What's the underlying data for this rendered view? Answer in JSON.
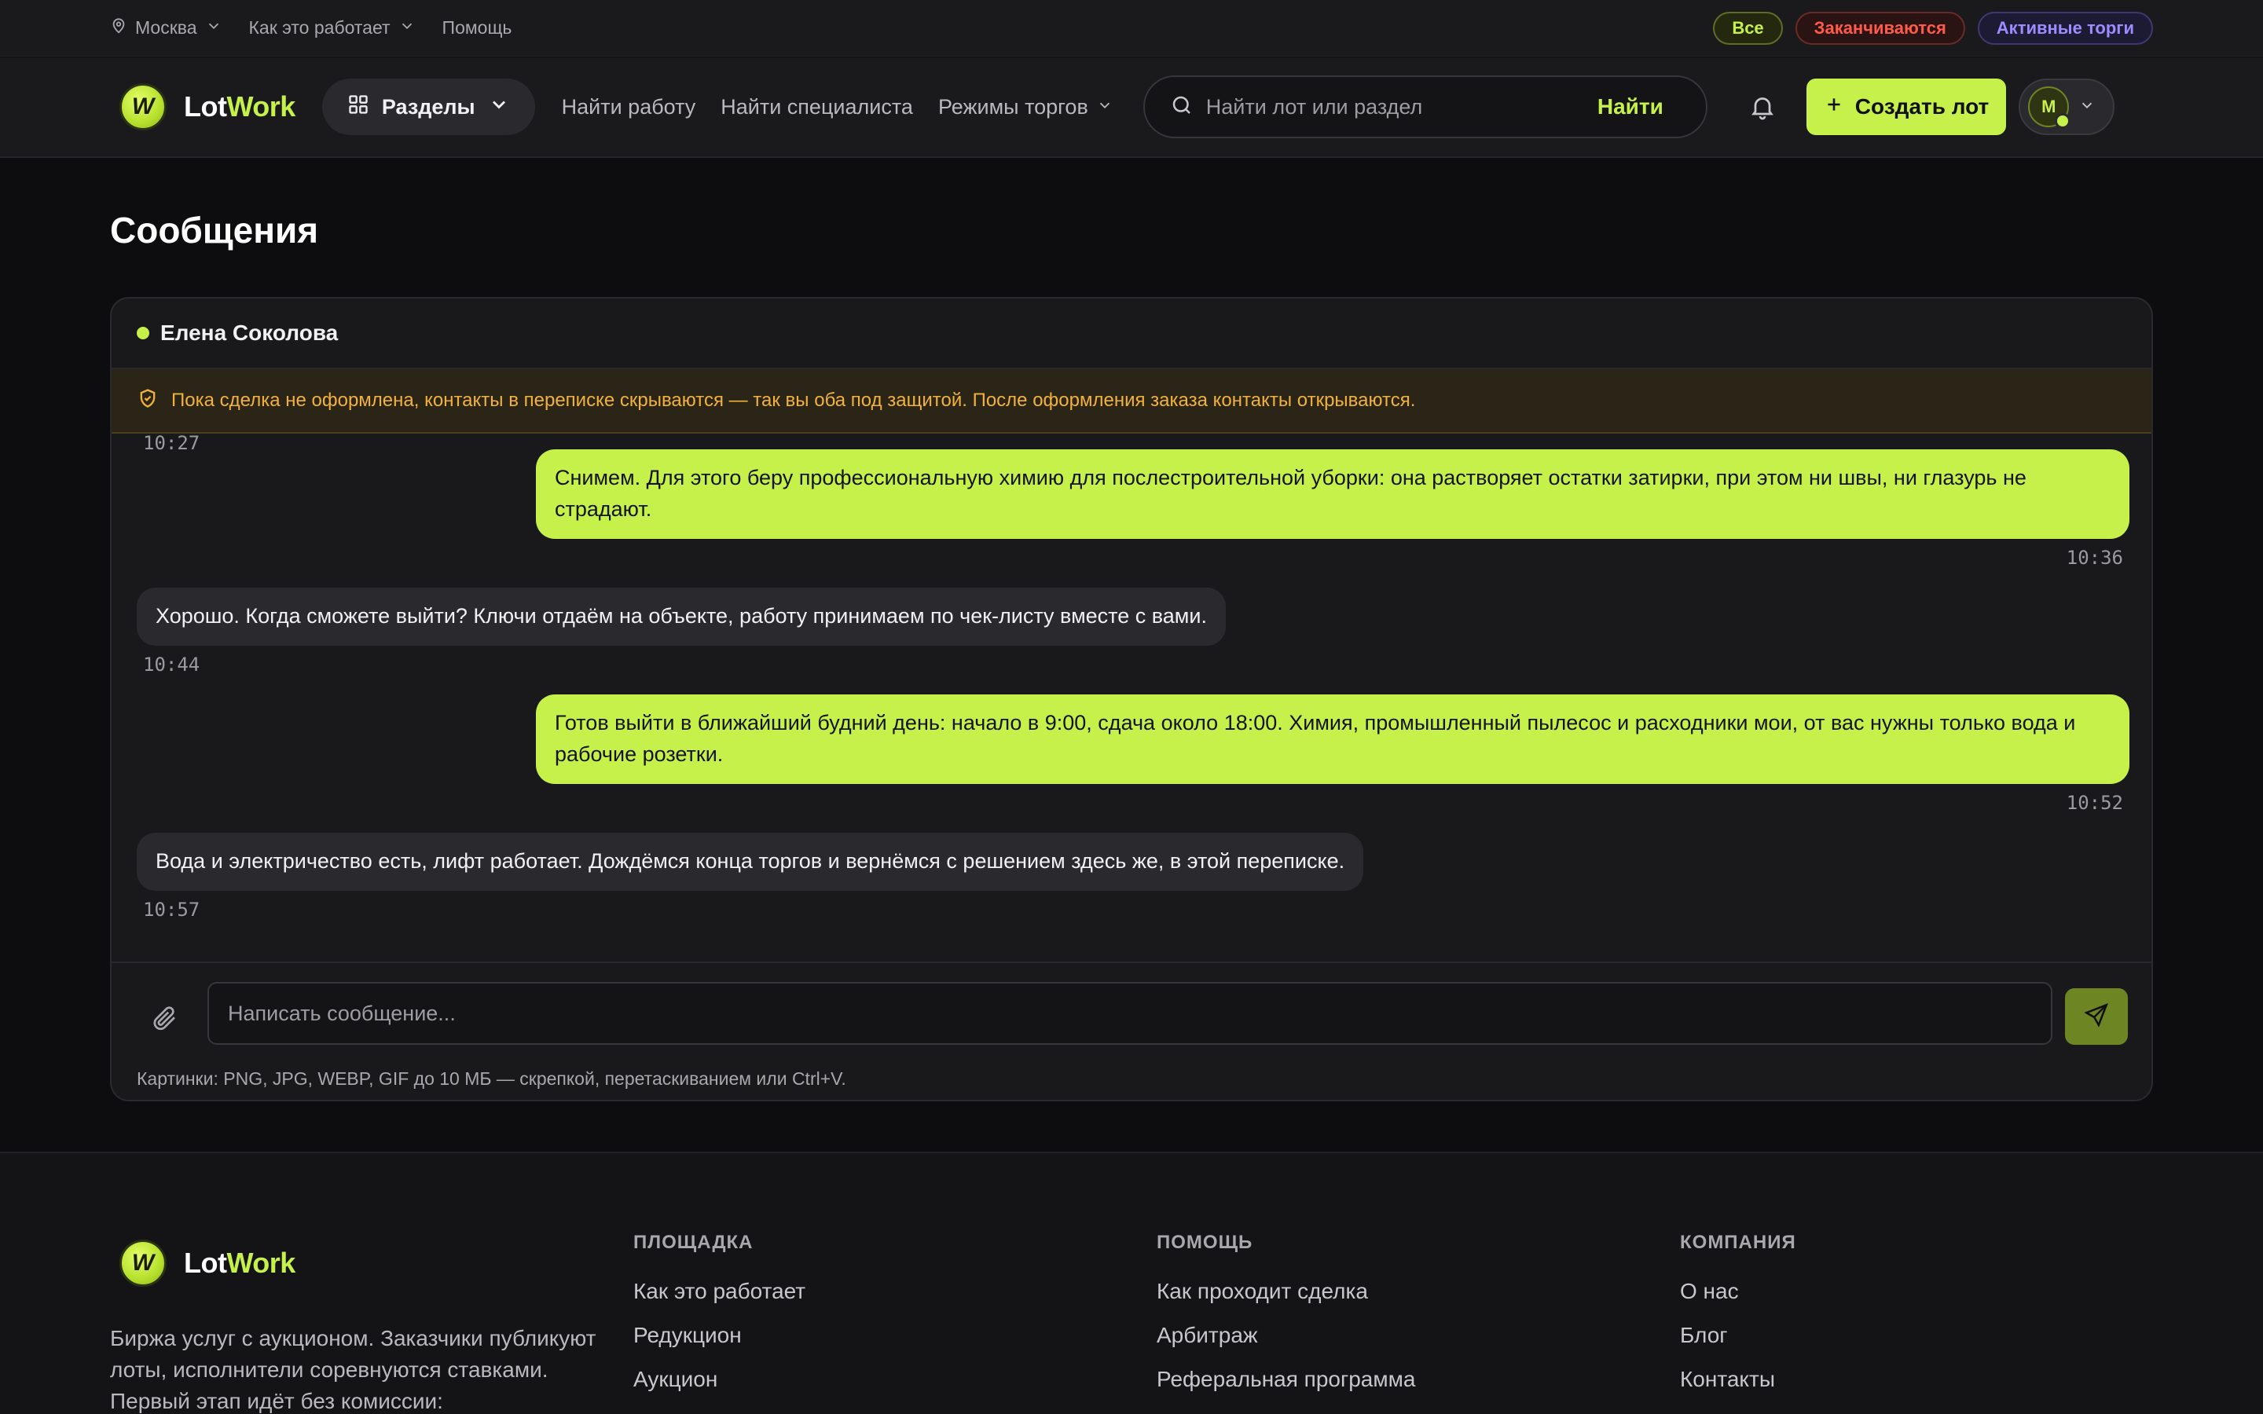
{
  "topbar": {
    "city": "Москва",
    "how_it_works": "Как это работает",
    "help": "Помощь",
    "filters": {
      "all": "Все",
      "ending": "Заканчиваются",
      "active": "Активные торги"
    }
  },
  "header": {
    "logo_lot": "Lot",
    "logo_work": "Work",
    "logo_mark": "W",
    "sections": "Разделы",
    "nav": {
      "find_job": "Найти работу",
      "find_specialist": "Найти специалиста",
      "trade_modes": "Режимы торгов"
    },
    "search_placeholder": "Найти лот или раздел",
    "search_button": "Найти",
    "create_lot": "Создать лот",
    "avatar_initial": "М"
  },
  "page": {
    "title": "Сообщения"
  },
  "chat": {
    "contact_name": "Елена Соколова",
    "notice": "Пока сделка не оформлена, контакты в переписке скрываются — так вы оба под защитой. После оформления заказа контакты открываются.",
    "cut_time": "10:27",
    "messages": [
      {
        "direction": "out",
        "text": "Снимем. Для этого беру профессиональную химию для послестроительной уборки: она растворяет остатки затирки, при этом ни швы, ни глазурь не страдают.",
        "time": "10:36"
      },
      {
        "direction": "in",
        "text": "Хорошо. Когда сможете выйти? Ключи отдаём на объекте, работу принимаем по чек-листу вместе с вами.",
        "time": "10:44"
      },
      {
        "direction": "out",
        "text": "Готов выйти в ближайший будний день: начало в 9:00, сдача около 18:00. Химия, промышленный пылесос и расходники мои, от вас нужны только вода и рабочие розетки.",
        "time": "10:52"
      },
      {
        "direction": "in",
        "text": "Вода и электричество есть, лифт работает. Дождёмся конца торгов и вернёмся с решением здесь же, в этой переписке.",
        "time": "10:57"
      }
    ],
    "input_placeholder": "Написать сообщение...",
    "hint": "Картинки: PNG, JPG, WEBP, GIF до 10 МБ — скрепкой, перетаскиванием или Ctrl+V."
  },
  "footer": {
    "about": "Биржа услуг с аукционом. Заказчики публикуют лоты, исполнители соревнуются ставками. Первый этап идёт без комиссии:",
    "columns": [
      {
        "title": "ПЛОЩАДКА",
        "links": [
          "Как это работает",
          "Редукцион",
          "Аукцион"
        ]
      },
      {
        "title": "ПОМОЩЬ",
        "links": [
          "Как проходит сделка",
          "Арбитраж",
          "Реферальная программа"
        ]
      },
      {
        "title": "КОМПАНИЯ",
        "links": [
          "О нас",
          "Блог",
          "Контакты"
        ]
      }
    ]
  },
  "colors": {
    "accent": "#c6f04a",
    "background": "#0d0d0f",
    "surface": "#19191c",
    "warning": "#f2b23a",
    "danger": "#ff5a4a",
    "violet": "#9b8cff"
  },
  "icons": [
    "location-pin-icon",
    "chevron-down-icon",
    "grid-icon",
    "search-icon",
    "bell-icon",
    "plus-icon",
    "shield-check-icon",
    "paperclip-icon",
    "send-icon"
  ]
}
